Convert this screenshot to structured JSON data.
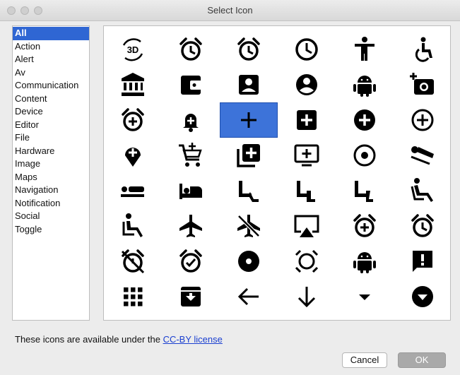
{
  "window": {
    "title": "Select Icon"
  },
  "categories": {
    "items": [
      "All",
      "Action",
      "Alert",
      "Av",
      "Communication",
      "Content",
      "Device",
      "Editor",
      "File",
      "Hardware",
      "Image",
      "Maps",
      "Navigation",
      "Notification",
      "Social",
      "Toggle"
    ],
    "selected": "All"
  },
  "icons": {
    "rows": [
      [
        "3d-rotation-icon",
        "alarm-icon",
        "alarm-icon",
        "clock-icon",
        "accessibility-icon",
        "accessible-icon"
      ],
      [
        "account-balance-icon",
        "account-balance-wallet-icon",
        "account-box-icon",
        "account-circle-icon",
        "android-icon",
        "add-a-photo-icon"
      ],
      [
        "add-alarm-icon",
        "add-alert-icon",
        "add-icon",
        "add-box-icon",
        "add-circle-icon",
        "add-circle-outline-icon"
      ],
      [
        "add-location-icon",
        "add-shopping-cart-icon",
        "add-to-photos-icon",
        "add-to-queue-icon",
        "adjust-icon",
        "airline-seat-flat-angled-icon"
      ],
      [
        "airline-seat-flat-icon",
        "airline-seat-individual-suite-icon",
        "airline-seat-legroom-extra-icon",
        "airline-seat-legroom-normal-icon",
        "airline-seat-legroom-reduced-icon",
        "airline-seat-recline-extra-icon"
      ],
      [
        "airline-seat-recline-normal-icon",
        "airplane-icon",
        "airplanemode-inactive-icon",
        "airplay-icon",
        "alarm-add-icon",
        "alarm-icon"
      ],
      [
        "alarm-off-icon",
        "alarm-on-icon",
        "album-icon",
        "all-out-icon",
        "android-icon",
        "announcement-icon"
      ],
      [
        "apps-icon",
        "archive-icon",
        "arrow-back-icon",
        "arrow-downward-icon",
        "arrow-drop-down-icon",
        "arrow-drop-down-circle-icon"
      ]
    ],
    "selected_icon": "add-icon",
    "icon_text_3d": "3D"
  },
  "footer": {
    "license_prefix": "These icons are available under the ",
    "license_link": "CC-BY license"
  },
  "buttons": {
    "cancel": "Cancel",
    "ok": "OK"
  },
  "colors": {
    "selection": "#3d73d9",
    "link": "#1a3fd0",
    "ok_disabled": "#a9a9a9"
  }
}
